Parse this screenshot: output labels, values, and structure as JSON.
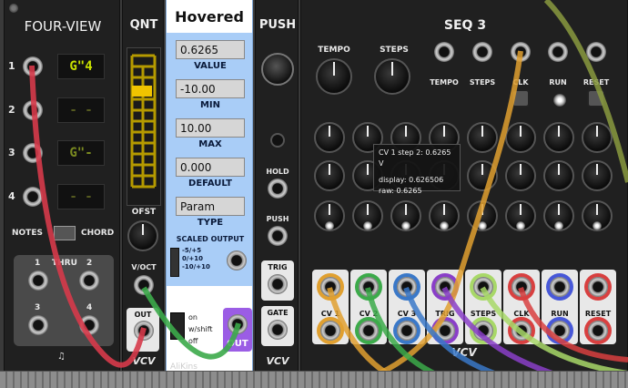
{
  "four_view": {
    "title": "FOUR-VIEW",
    "rows": [
      "1",
      "2",
      "3",
      "4"
    ],
    "displays": [
      "G\"4",
      "- -",
      "G\"-",
      "- -"
    ],
    "notes_label": "NOTES",
    "chord_label": "CHORD",
    "thru_label": "THRU",
    "thru_ports": [
      "1",
      "2",
      "3",
      "4"
    ]
  },
  "qnt": {
    "title": "QNT",
    "ofst_label": "OFST",
    "voct_label": "V/OCT",
    "out_label": "OUT",
    "brand": "VCV"
  },
  "hovered": {
    "title": "Hovered",
    "value": "0.6265",
    "value_label": "VALUE",
    "min": "-10.00",
    "min_label": "MIN",
    "max": "10.00",
    "max_label": "MAX",
    "default": "0.000",
    "default_label": "DEFAULT",
    "type": "Param",
    "type_label": "TYPE",
    "scaled_label": "SCALED OUTPUT",
    "ranges": [
      "-5/+5",
      "0/+10",
      "-10/+10"
    ],
    "mode_on": "on",
    "mode_shift": "w/shift",
    "mode_off": "off",
    "out_label": "OUT",
    "brand_bottom": "AliKins"
  },
  "push": {
    "title": "PUSH",
    "hold_label": "HOLD",
    "push_label": "PUSH",
    "trig_label": "TRIG",
    "gate_label": "GATE",
    "brand": "VCV"
  },
  "seq3": {
    "title": "SEQ 3",
    "tempo_label": "TEMPO",
    "steps_label": "STEPS",
    "small_labels": [
      "TEMPO",
      "STEPS",
      "CLK",
      "RUN",
      "RESET"
    ],
    "out_labels": [
      "CV 1",
      "CV 2",
      "CV 3",
      "TRIG",
      "STEPS",
      "CLK",
      "RUN",
      "RESET"
    ],
    "out_colors": [
      "#e0a030",
      "#3caa4a",
      "#3a78c8",
      "#8a3fc8",
      "#a8d868",
      "#d84040",
      "#4858d8",
      "#d84040"
    ],
    "tooltip_line1": "CV 1 step 2: 0.6265 V",
    "tooltip_line2": "display: 0.626506",
    "tooltip_line3": "raw: 0.6265",
    "brand": "VCV"
  },
  "colors": {
    "hovered_panel": "#a9cdf7",
    "lcd": "#c8e000",
    "cable_red": "#d63a4a",
    "cable_yellow": "#e0a030",
    "cable_green": "#3caa4a",
    "cable_purple": "#8a3fc8",
    "cable_blue": "#4a6be0"
  }
}
